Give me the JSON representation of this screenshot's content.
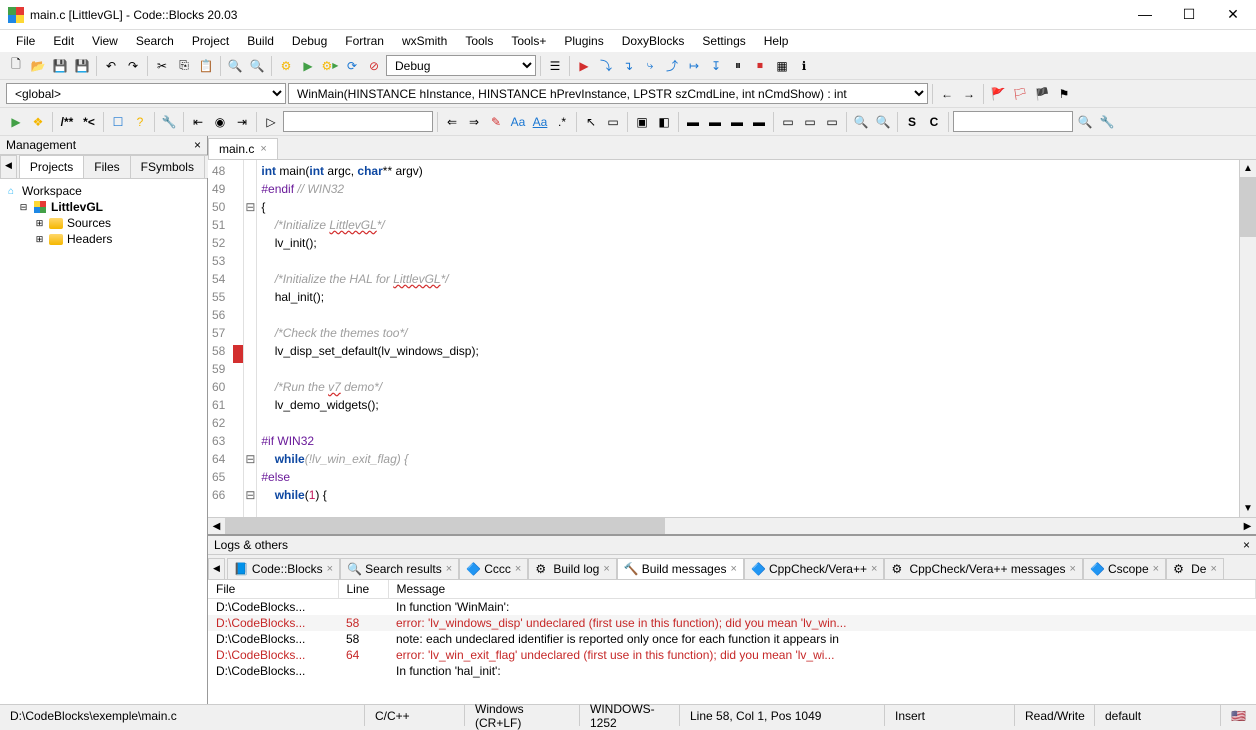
{
  "window": {
    "title": "main.c [LittlevGL] - Code::Blocks 20.03"
  },
  "menus": [
    "File",
    "Edit",
    "View",
    "Search",
    "Project",
    "Build",
    "Debug",
    "Fortran",
    "wxSmith",
    "Tools",
    "Tools+",
    "Plugins",
    "DoxyBlocks",
    "Settings",
    "Help"
  ],
  "toolbar1": {
    "build_target": "Debug"
  },
  "toolbar2": {
    "scope": "<global>",
    "symbol": "WinMain(HINSTANCE hInstance, HINSTANCE hPrevInstance, LPSTR szCmdLine, int nCmdShow) : int"
  },
  "management": {
    "title": "Management",
    "tabs": [
      "Projects",
      "Files",
      "FSymbols"
    ],
    "workspace": "Workspace",
    "project": "LittlevGL",
    "folders": [
      "Sources",
      "Headers"
    ]
  },
  "editor": {
    "tab": "main.c",
    "first_line": 48,
    "lines": [
      {
        "n": 48,
        "html": "<span class='kw'>int</span> <span class='fn'>main</span>(<span class='kw'>int</span> argc, <span class='kw'>char</span>** argv)"
      },
      {
        "n": 49,
        "html": "<span class='pre'>#endif</span> <span class='cmt'>// WIN32</span>"
      },
      {
        "n": 50,
        "fold": "⊟",
        "html": "{"
      },
      {
        "n": 51,
        "html": "    <span class='cmt'>/*Initialize <span class='underline-wavy'>LittlevGL</span>*/</span>"
      },
      {
        "n": 52,
        "html": "    lv_init();"
      },
      {
        "n": 53,
        "html": ""
      },
      {
        "n": 54,
        "html": "    <span class='cmt'>/*Initialize the HAL for <span class='underline-wavy'>LittlevGL</span>*/</span>"
      },
      {
        "n": 55,
        "html": "    hal_init();"
      },
      {
        "n": 56,
        "html": ""
      },
      {
        "n": 57,
        "html": "    <span class='cmt'>/*Check the themes too*/</span>"
      },
      {
        "n": 58,
        "bp": true,
        "html": "    lv_disp_set_default(lv_windows_disp);"
      },
      {
        "n": 59,
        "html": ""
      },
      {
        "n": 60,
        "html": "    <span class='cmt'>/*Run the <span class='underline-wavy'>v7</span> demo*/</span>"
      },
      {
        "n": 61,
        "html": "    lv_demo_widgets();"
      },
      {
        "n": 62,
        "html": ""
      },
      {
        "n": 63,
        "html": "<span class='pre'>#if WIN32</span>"
      },
      {
        "n": 64,
        "fold": "⊟",
        "html": "    <span class='kw'>while</span><span class='cmt'>(!lv_win_exit_flag) {</span>"
      },
      {
        "n": 65,
        "html": "<span class='pre'>#else</span>"
      },
      {
        "n": 66,
        "fold": "⊟",
        "html": "    <span class='kw'>while</span>(<span class='num'>1</span>) {"
      }
    ]
  },
  "logs": {
    "title": "Logs & others",
    "tabs": [
      "Code::Blocks",
      "Search results",
      "Cccc",
      "Build log",
      "Build messages",
      "CppCheck/Vera++",
      "CppCheck/Vera++ messages",
      "Cscope",
      "De"
    ],
    "active_tab": 4,
    "headers": [
      "File",
      "Line",
      "Message"
    ],
    "rows": [
      {
        "file": "D:\\CodeBlocks...",
        "line": "",
        "msg": "In function 'WinMain':",
        "err": false
      },
      {
        "file": "D:\\CodeBlocks...",
        "line": "58",
        "msg": "error: 'lv_windows_disp' undeclared (first use in this function); did you mean 'lv_win...",
        "err": true,
        "selected": true
      },
      {
        "file": "D:\\CodeBlocks...",
        "line": "58",
        "msg": "note: each undeclared identifier is reported only once for each function it appears in",
        "err": false
      },
      {
        "file": "D:\\CodeBlocks...",
        "line": "64",
        "msg": "error: 'lv_win_exit_flag' undeclared (first use in this function); did you mean 'lv_wi...",
        "err": true
      },
      {
        "file": "D:\\CodeBlocks...",
        "line": "",
        "msg": "In function 'hal_init':",
        "err": false
      }
    ]
  },
  "status": {
    "path": "D:\\CodeBlocks\\exemple\\main.c",
    "lang": "C/C++",
    "eol": "Windows (CR+LF)",
    "enc": "WINDOWS-1252",
    "pos": "Line 58, Col 1, Pos 1049",
    "mode": "Insert",
    "rw": "Read/Write",
    "profile": "default"
  }
}
